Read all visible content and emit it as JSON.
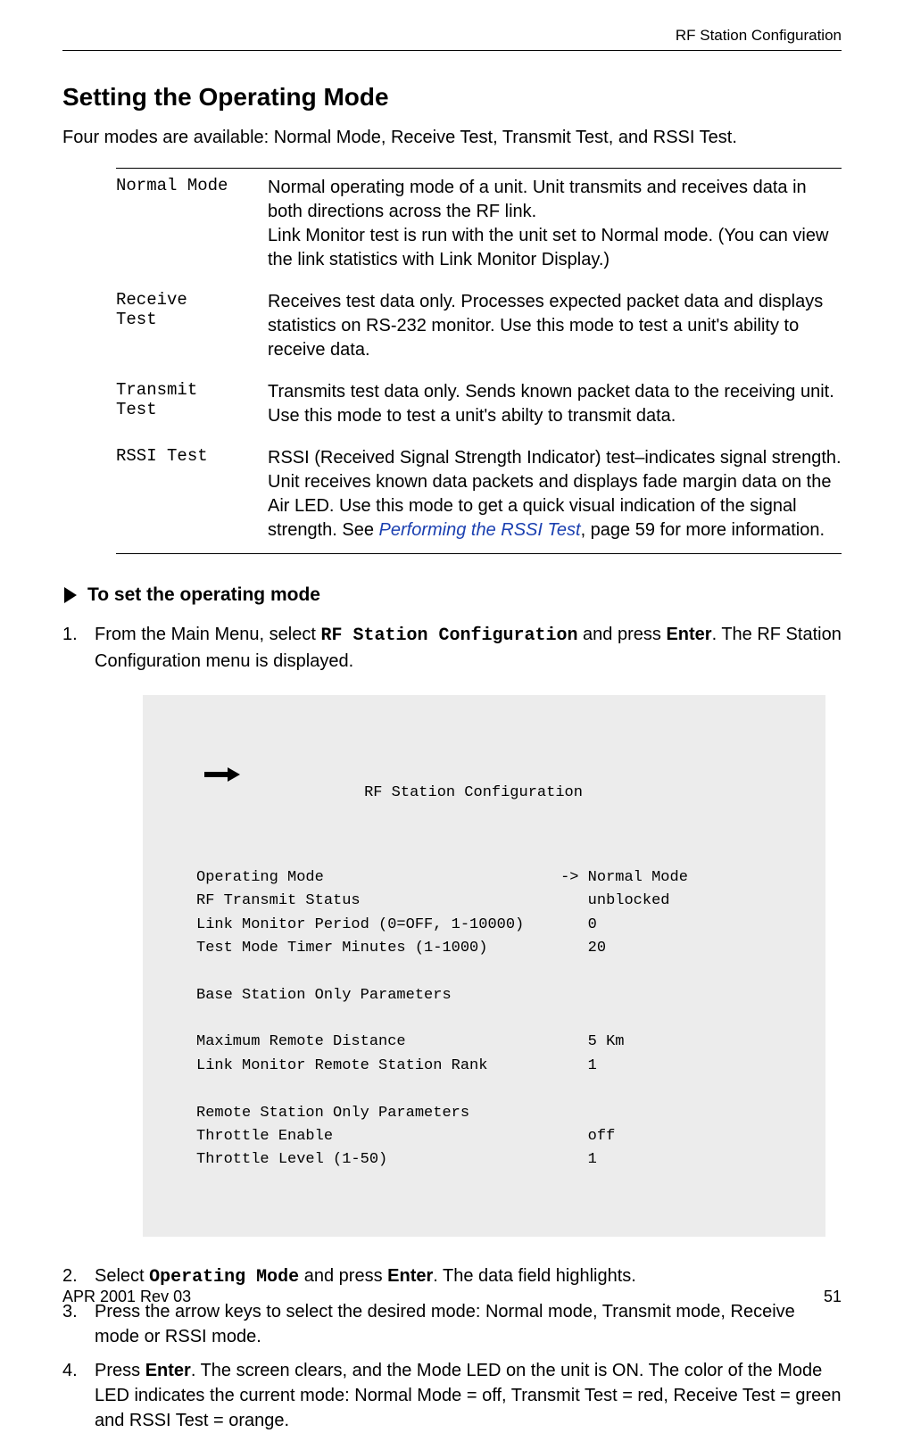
{
  "header": {
    "right": "RF Station Configuration"
  },
  "title": "Setting the Operating Mode",
  "intro": "Four modes are available: Normal Mode, Receive Test, Transmit Test, and RSSI Test.",
  "modes": [
    {
      "name": "Normal Mode",
      "desc_html": "Normal operating mode of a unit. Unit transmits and receives data in both directions across the RF link.<br>Link Monitor test is run with the unit set to Normal mode. (You can view the link statistics with Link Monitor Display.)"
    },
    {
      "name": "Receive\nTest",
      "desc_html": "Receives test data only. Processes expected packet data and displays statistics on RS-232 monitor. Use this mode to test a unit's ability to receive data."
    },
    {
      "name": "Transmit\nTest",
      "desc_html": "Transmits test data only. Sends known packet data to the receiving unit. Use this mode to test a unit's abilty to transmit data."
    },
    {
      "name": "RSSI Test",
      "desc_html": "RSSI (Received Signal Strength Indicator) test–indicates signal strength. Unit receives known data packets and displays fade margin data on the Air LED. Use this mode to get a quick visual indication of the signal strength. See <span class=\"link\">Performing the RSSI Test</span>, page 59 for more information."
    }
  ],
  "subheader": "To set the operating mode",
  "steps": {
    "s1": {
      "prefix": "From the Main Menu, select ",
      "cmd": "RF Station Configuration",
      "mid": " and press ",
      "key": "Enter",
      "suffix": ". The RF Station Configuration menu is displayed."
    },
    "s2": {
      "prefix": "Select ",
      "cmd": "Operating Mode",
      "mid": " and press ",
      "key": "Enter",
      "suffix": ". The data field highlights."
    },
    "s3": {
      "text": "Press the arrow keys to select the desired mode: Normal mode, Transmit mode, Receive mode or RSSI mode."
    },
    "s4": {
      "prefix": "Press ",
      "key": "Enter",
      "suffix": ". The screen clears, and the Mode LED on the unit is ON. The color of the Mode LED indicates the current mode: Normal Mode = off, Transmit Test = red, Receive Test = green and RSSI Test = orange."
    }
  },
  "terminal": {
    "title": "RF Station Configuration",
    "rows": [
      {
        "label": "Operating Mode",
        "value": "-> Normal Mode"
      },
      {
        "label": "RF Transmit Status",
        "value": "   unblocked"
      },
      {
        "label": "Link Monitor Period (0=OFF, 1-10000)",
        "value": "   0"
      },
      {
        "label": "Test Mode Timer Minutes (1-1000)",
        "value": "   20"
      },
      {
        "label": "",
        "value": ""
      },
      {
        "label": "Base Station Only Parameters",
        "value": ""
      },
      {
        "label": "",
        "value": ""
      },
      {
        "label": "Maximum Remote Distance",
        "value": "   5 Km"
      },
      {
        "label": "Link Monitor Remote Station Rank",
        "value": "   1"
      },
      {
        "label": "",
        "value": ""
      },
      {
        "label": "Remote Station Only Parameters",
        "value": ""
      },
      {
        "label": "Throttle Enable",
        "value": "   off"
      },
      {
        "label": "Throttle Level (1-50)",
        "value": "   1"
      }
    ]
  },
  "footer": {
    "left": "APR 2001 Rev 03",
    "right": "51"
  }
}
